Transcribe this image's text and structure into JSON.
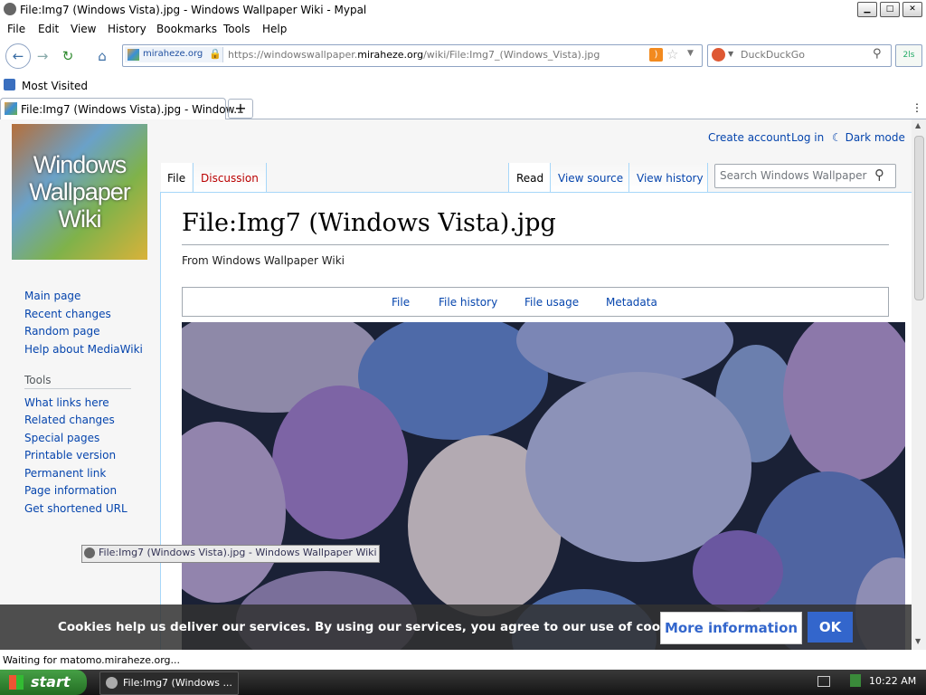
{
  "window": {
    "title": "File:Img7 (Windows Vista).jpg - Windows Wallpaper Wiki - Mypal",
    "min": "▁",
    "max": "□",
    "close": "✕"
  },
  "menu": [
    "File",
    "Edit",
    "View",
    "History",
    "Bookmarks",
    "Tools",
    "Help"
  ],
  "nav": {
    "back_icon": "←",
    "forward_icon": "→",
    "reload_icon": "↻",
    "home_icon": "⌂",
    "site_identity": "miraheze.org",
    "url_prefix": "https://windowswallpaper.",
    "url_domain": "miraheze.org",
    "url_suffix": "/wiki/File:Img7_(Windows_Vista).jpg",
    "search_placeholder": "DuckDuckGo",
    "ext_label": "2ls"
  },
  "bookmarks": {
    "most_visited": "Most Visited"
  },
  "tabs": [
    {
      "label": "File:Img7 (Windows Vista).jpg - Window..."
    }
  ],
  "new_tab": "+",
  "wiki": {
    "logo_lines": [
      "Windows",
      "Wallpaper",
      "Wiki"
    ],
    "personal": [
      "Create account",
      "Log in",
      "☾ Dark mode"
    ],
    "left_tabs": [
      "File",
      "Discussion"
    ],
    "right_tabs": [
      "Read",
      "View source",
      "View history"
    ],
    "search_placeholder": "Search Windows Wallpaper Wiki",
    "heading": "File:Img7 (Windows Vista).jpg",
    "subtitle": "From Windows Wallpaper Wiki",
    "file_tabs": [
      "File",
      "File history",
      "File usage",
      "Metadata"
    ],
    "nav_links": [
      "Main page",
      "Recent changes",
      "Random page",
      "Help about MediaWiki"
    ],
    "tools_heading": "Tools",
    "tools_links": [
      "What links here",
      "Related changes",
      "Special pages",
      "Printable version",
      "Permanent link",
      "Page information",
      "Get shortened URL"
    ]
  },
  "tooltip": "File:Img7 (Windows Vista).jpg - Windows Wallpaper Wiki",
  "cookie": {
    "text": "Cookies help us deliver our services. By using our services, you agree to our use of cookies.",
    "more": "More information",
    "ok": "OK"
  },
  "status": "Waiting for matomo.miraheze.org...",
  "taskbar": {
    "start": "start",
    "task": "File:Img7 (Windows ...",
    "clock": "10:22 AM"
  }
}
